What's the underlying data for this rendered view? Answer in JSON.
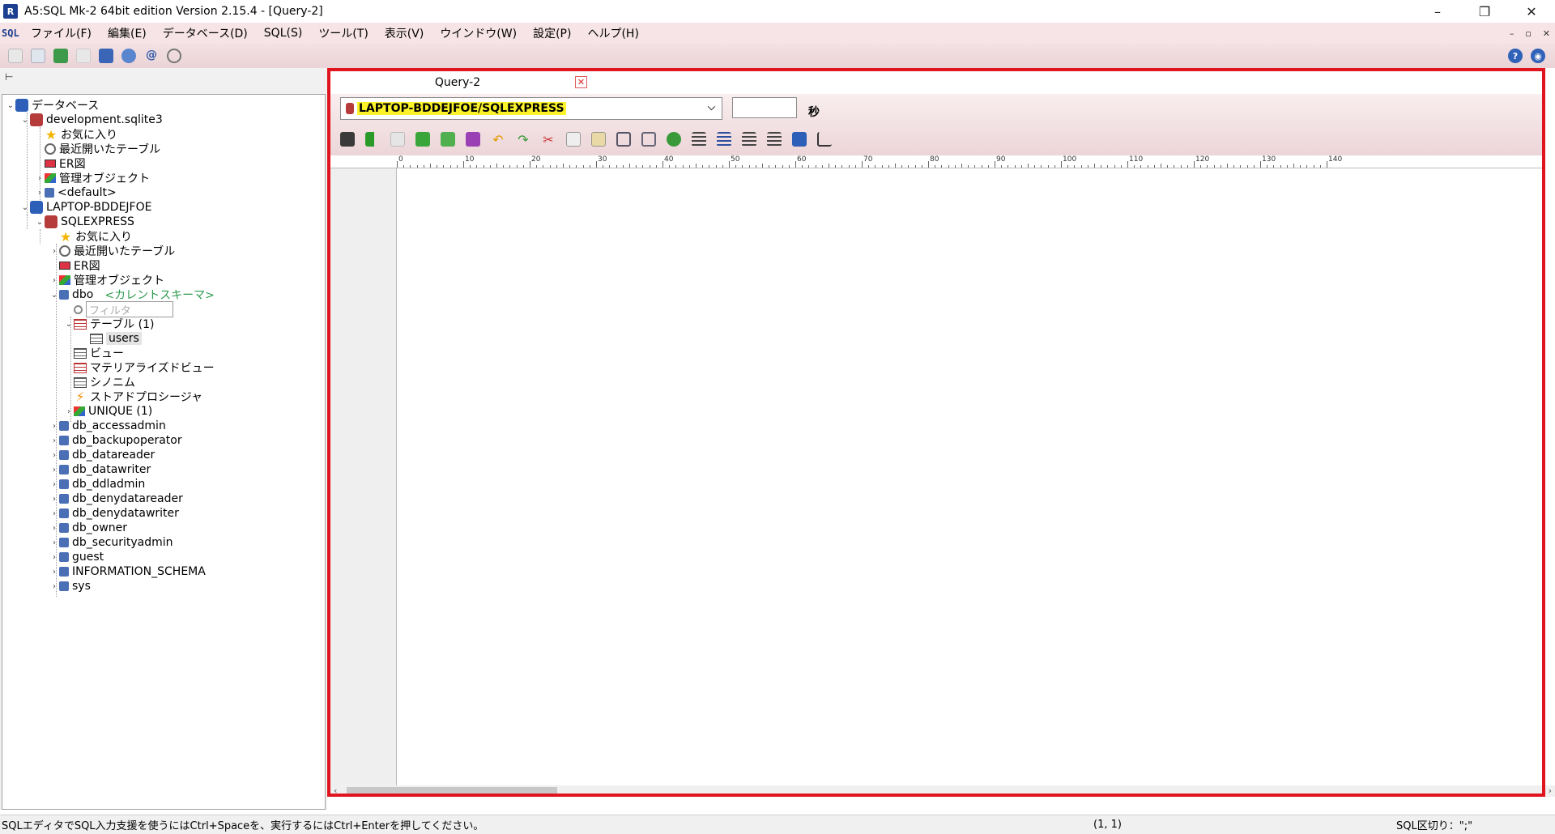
{
  "window": {
    "title": "A5:SQL Mk-2 64bit edition Version 2.15.4 - [Query-2]",
    "app_icon_glyph": "R",
    "controls": [
      "–",
      "❐",
      "✕"
    ]
  },
  "menubar": {
    "sql_icon_text": "SQL",
    "items": [
      "ファイル(F)",
      "編集(E)",
      "データベース(D)",
      "SQL(S)",
      "ツール(T)",
      "表示(V)",
      "ウインドウ(W)",
      "設定(P)",
      "ヘルプ(H)"
    ],
    "mdi_controls": [
      "–",
      "▫",
      "✕"
    ]
  },
  "toolbar": {
    "help_glyph": "?",
    "web_glyph": "◉",
    "at_glyph": "@"
  },
  "tree": {
    "root": "データベース",
    "db1": "development.sqlite3",
    "db1_children": [
      "お気に入り",
      "最近開いたテーブル",
      "ER図",
      "管理オブジェクト",
      "<default>"
    ],
    "db2": "LAPTOP-BDDEJFOE",
    "instance": "SQLEXPRESS",
    "inst_children": [
      "お気に入り",
      "最近開いたテーブル",
      "ER図",
      "管理オブジェクト"
    ],
    "dbo": "dbo",
    "dbo_hint": "<カレントスキーマ>",
    "filter_placeholder": "フィルタ",
    "tables": "テーブル (1)",
    "users": "users",
    "dbo_children": [
      "ビュー",
      "マテリアライズドビュー",
      "シノニム",
      "ストアドプロシージャ",
      "UNIQUE (1)"
    ],
    "schemas": [
      "db_accessadmin",
      "db_backupoperator",
      "db_datareader",
      "db_datawriter",
      "db_ddladmin",
      "db_denydatareader",
      "db_denydatawriter",
      "db_owner",
      "db_securityadmin",
      "guest",
      "INFORMATION_SCHEMA",
      "sys"
    ]
  },
  "query": {
    "tab_label": "Query-2",
    "tab_close": "✕",
    "connection": "LAPTOP-BDDEJFOE/SQLEXPRESS",
    "timeout_value": "",
    "sec_label": "秒",
    "ruler_labels": [
      "0",
      "10",
      "20",
      "30",
      "40",
      "50",
      "60",
      "70",
      "80",
      "90",
      "100",
      "110",
      "120",
      "130",
      "140"
    ]
  },
  "statusbar": {
    "message": "SQLエディタでSQL入力支援を使うにはCtrl+Spaceを、実行するにはCtrl+Enterを押してください。",
    "cursor": "(1, 1)",
    "separator": "SQL区切り：\";\""
  },
  "colors": {
    "frame_highlight": "#e0141e",
    "menubar_bg": "#f6e4e6",
    "connection_highlight": "#fbf22a",
    "current_schema_hint": "#2e9a4f"
  }
}
